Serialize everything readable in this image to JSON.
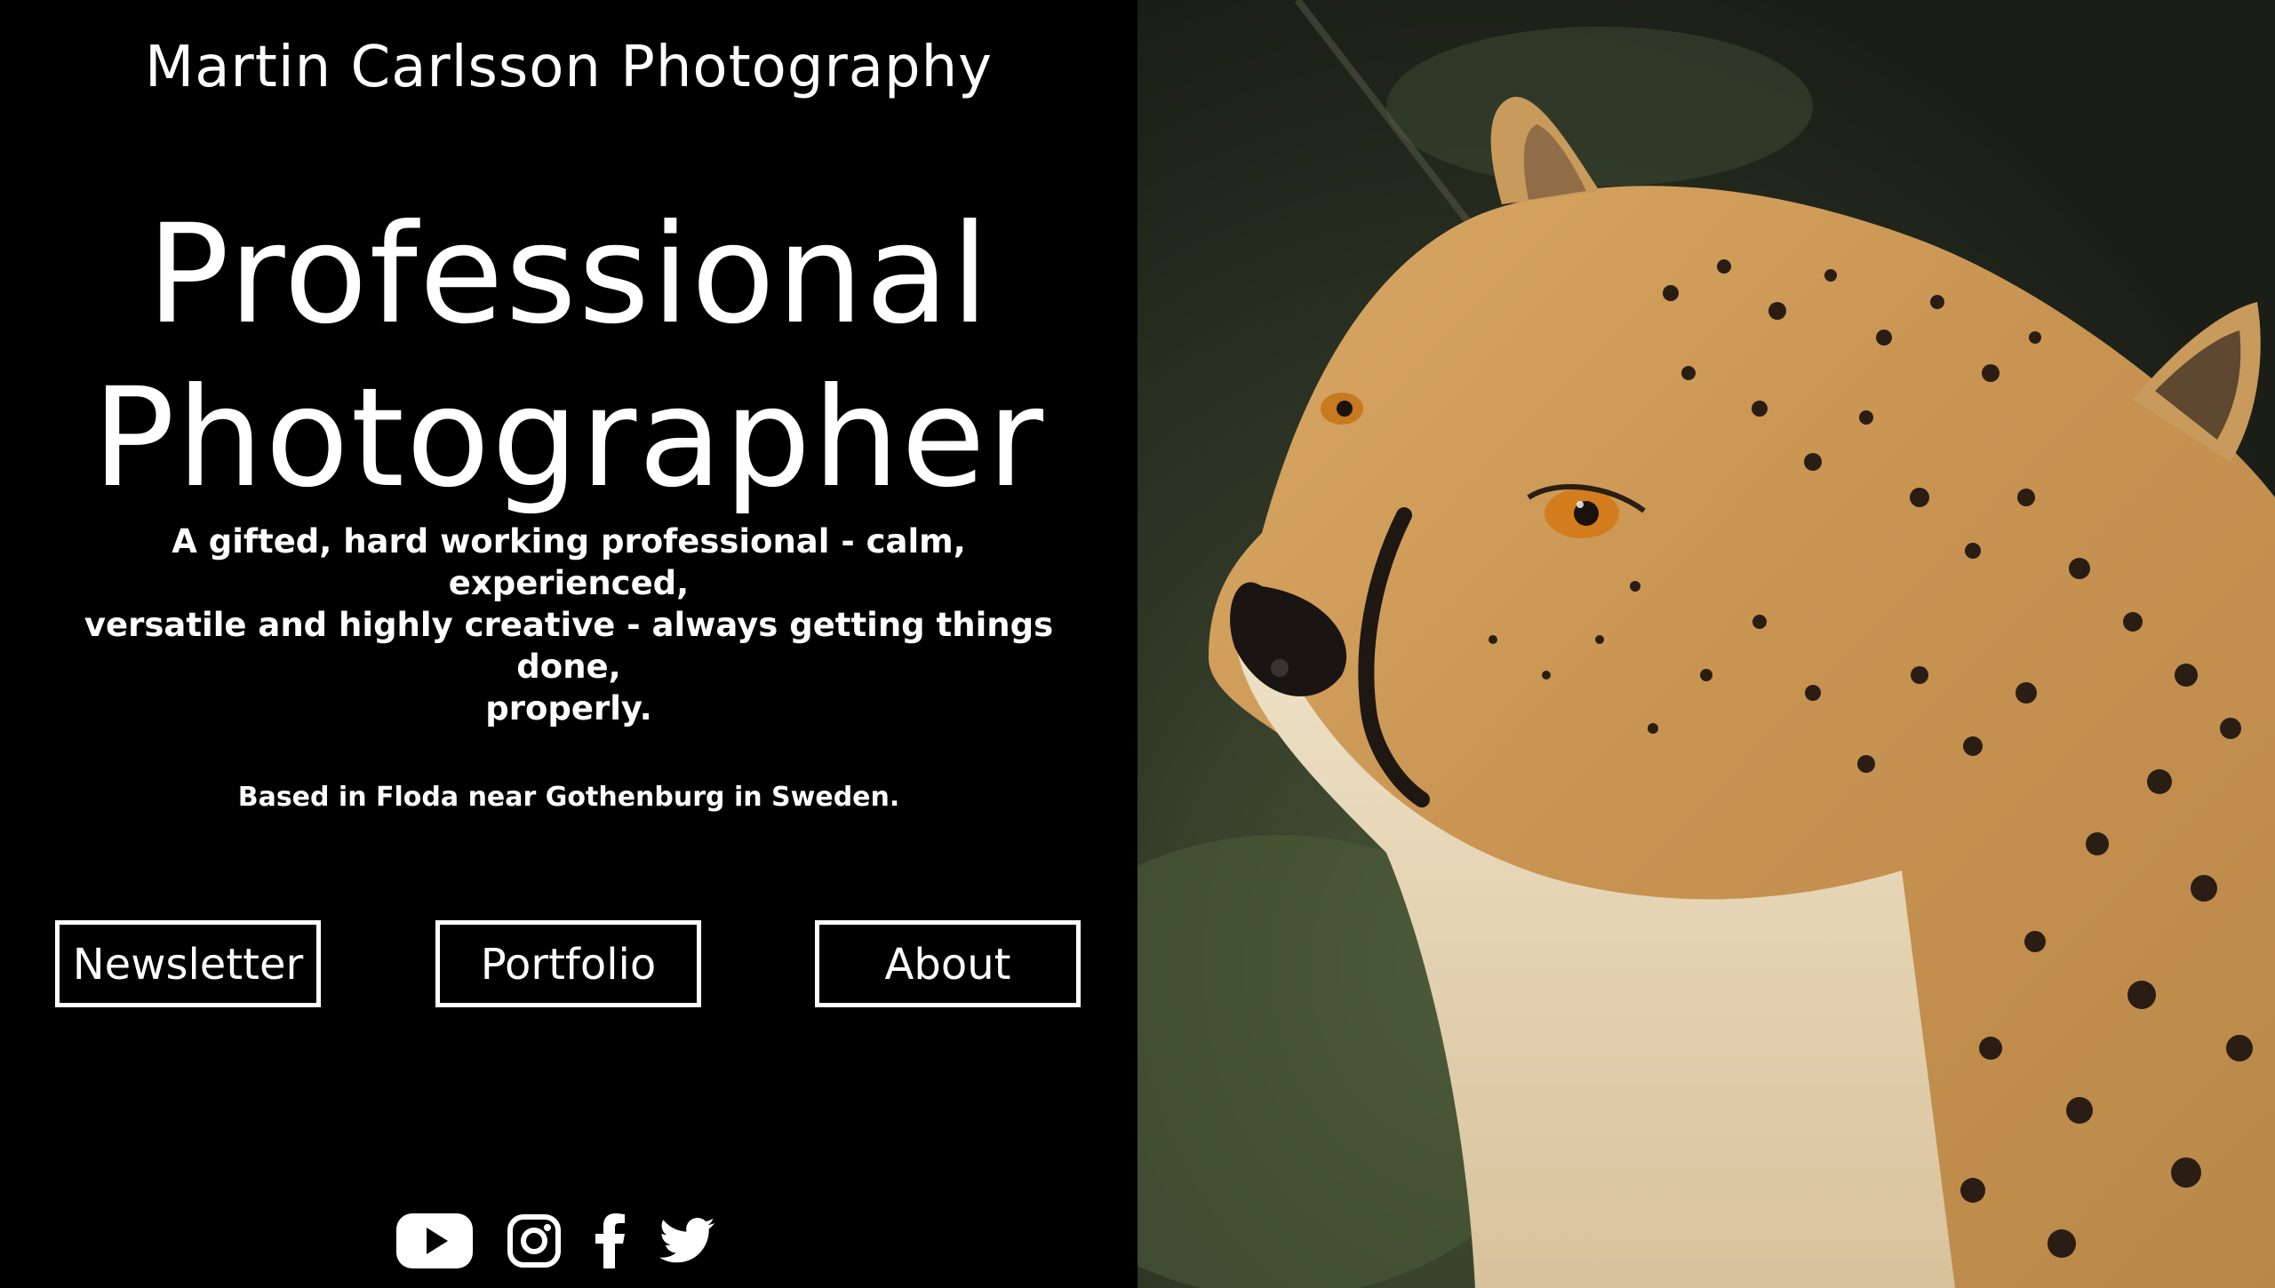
{
  "header": {
    "site_name": "Martin Carlsson Photography"
  },
  "hero": {
    "title_line1": "Professional",
    "title_line2": "Photographer",
    "tagline_line1": "A gifted, hard working professional - calm, experienced,",
    "tagline_line2": "versatile and highly creative - always getting things",
    "tagline_line3": "done,",
    "tagline_line4": "properly.",
    "location": "Based in Floda near Gothenburg in Sweden."
  },
  "nav": {
    "newsletter_label": "Newsletter",
    "portfolio_label": "Portfolio",
    "about_label": "About"
  },
  "social": {
    "icons": [
      "youtube-icon",
      "instagram-icon",
      "facebook-icon",
      "twitter-icon"
    ]
  },
  "image": {
    "subject": "cheetah-photo"
  },
  "colors": {
    "background": "#000000",
    "text": "#ffffff",
    "button_border": "#ffffff"
  }
}
